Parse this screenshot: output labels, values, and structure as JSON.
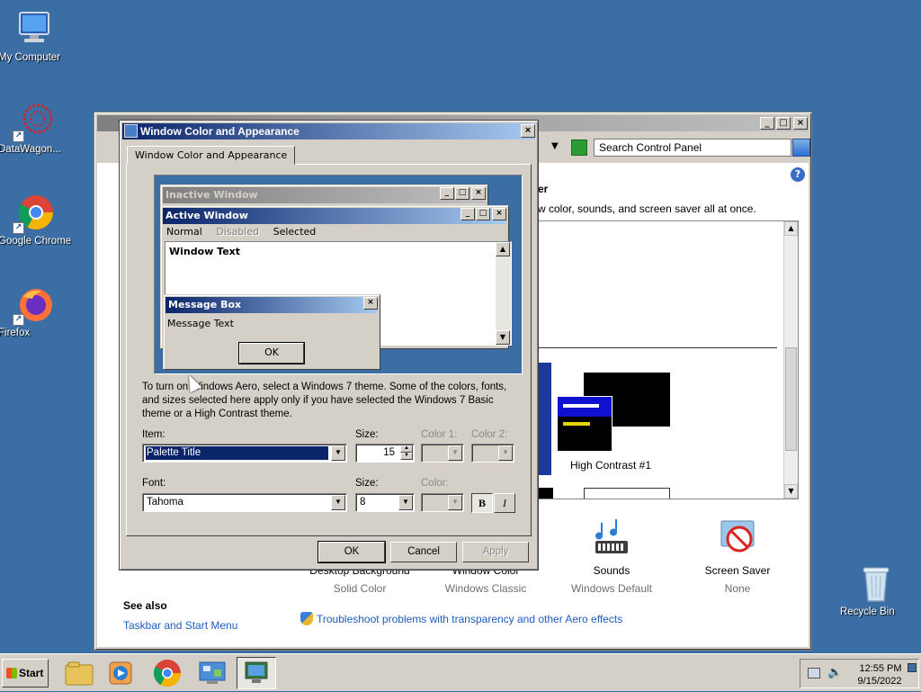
{
  "desktop": {
    "icons": [
      {
        "label": "My Computer"
      },
      {
        "label": "DataWagon..."
      },
      {
        "label": "Google Chrome"
      },
      {
        "label": "Firefox"
      },
      {
        "label": "Recycle Bin"
      }
    ]
  },
  "control_panel": {
    "search_placeholder": "Search Control Panel",
    "heading_fragment": "er",
    "description_fragment": "w color, sounds, and screen saver all at once.",
    "theme_high_contrast_label": "High Contrast #1",
    "items": [
      {
        "label": "Desktop Background",
        "sub": "Solid Color"
      },
      {
        "label": "Window Color",
        "sub": "Windows Classic"
      },
      {
        "label": "Sounds",
        "sub": "Windows Default"
      },
      {
        "label": "Screen Saver",
        "sub": "None"
      }
    ],
    "see_also_title": "See also",
    "see_also_link": "Taskbar and Start Menu",
    "troubleshoot_link": "Troubleshoot problems with transparency and other Aero effects"
  },
  "dialog": {
    "title": "Window Color and Appearance",
    "tab_label": "Window Color and Appearance",
    "preview": {
      "inactive_title": "Inactive Window",
      "active_title": "Active Window",
      "menu_normal": "Normal",
      "menu_disabled": "Disabled",
      "menu_selected": "Selected",
      "window_text": "Window Text",
      "msgbox_title": "Message Box",
      "msgbox_text": "Message Text",
      "msgbox_ok": "OK"
    },
    "description": "To turn on Windows Aero, select a Windows 7 theme.  Some of the colors, fonts, and sizes selected here apply only if you have selected the Windows 7 Basic theme or a High Contrast theme.",
    "item_label": "Item:",
    "item_value": "Palette Title",
    "size_label": "Size:",
    "size_value": "15",
    "color1_label": "Color 1:",
    "color2_label": "Color 2:",
    "font_label": "Font:",
    "font_value": "Tahoma",
    "font_size_label": "Size:",
    "font_size_value": "8",
    "font_color_label": "Color:",
    "bold_label": "B",
    "italic_label": "I",
    "ok_label": "OK",
    "cancel_label": "Cancel",
    "apply_label": "Apply"
  },
  "taskbar": {
    "start_label": "Start",
    "clock_time": "12:55 PM",
    "clock_date": "9/15/2022"
  },
  "colors": {
    "desktop": "#3a6ea5",
    "active_title_start": "#0a246a",
    "active_title_end": "#a6caf0",
    "face": "#d4d0c8"
  }
}
